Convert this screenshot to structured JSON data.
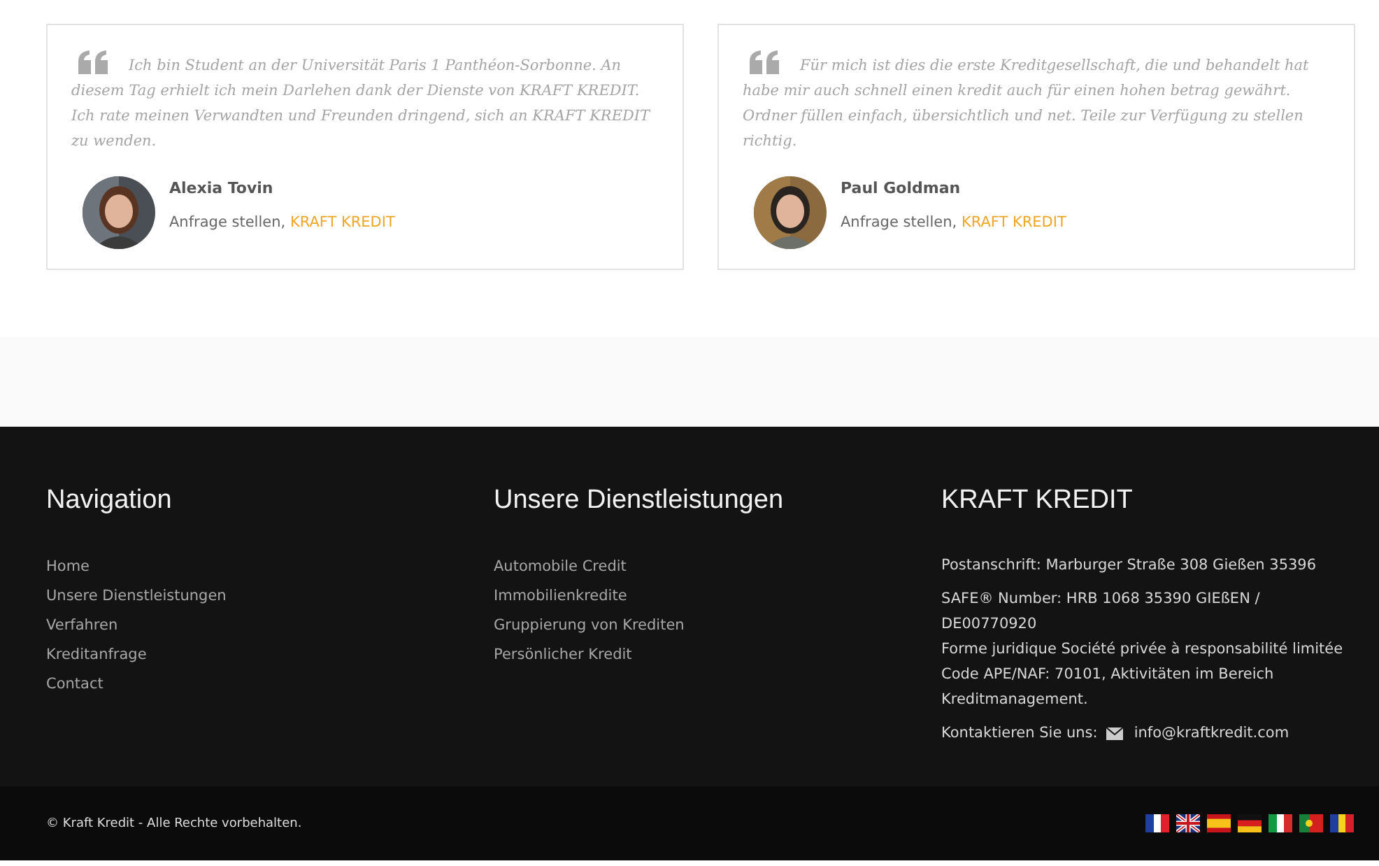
{
  "testimonials": [
    {
      "quote": "Ich bin Student an der Universität Paris 1 Panthéon-Sorbonne. An diesem Tag erhielt ich mein Darlehen dank der Dienste von KRAFT KREDIT. Ich rate meinen Verwandten und Freunden dringend, sich an KRAFT KREDIT zu wenden.",
      "name": "Alexia Tovin",
      "role": "Anfrage stellen,",
      "company": "KRAFT KREDIT"
    },
    {
      "quote": "Für mich ist dies die erste Kreditgesellschaft, die und behandelt hat habe mir auch schnell einen kredit auch für einen hohen betrag gewährt. Ordner füllen einfach, übersichtlich und net. Teile zur Verfügung zu stellen richtig.",
      "name": "Paul Goldman",
      "role": "Anfrage stellen,",
      "company": "KRAFT KREDIT"
    }
  ],
  "footer": {
    "navigation": {
      "title": "Navigation",
      "links": [
        "Home",
        "Unsere Dienstleistungen",
        "Verfahren",
        "Kreditanfrage",
        "Contact"
      ]
    },
    "services": {
      "title": "Unsere Dienstleistungen",
      "links": [
        "Automobile Credit",
        "Immobilienkredite",
        "Gruppierung von Krediten",
        "Persönlicher Kredit"
      ]
    },
    "company": {
      "title": "KRAFT KREDIT",
      "address": "Postanschrift: Marburger Straße 308 Gießen 35396",
      "legal": [
        "SAFE® Number: HRB 1068 35390 GIEßEN / DE00770920",
        "Forme juridique Société privée à responsabilité limitée",
        "Code APE/NAF: 70101, Aktivitäten im Bereich Kreditmanagement."
      ],
      "contact_label": "Kontaktieren Sie uns:",
      "email": "info@kraftkredit.com"
    }
  },
  "bottom_bar": {
    "copyright": "© Kraft Kredit - Alle Rechte vorbehalten.",
    "flags": [
      {
        "kind": "fr"
      },
      {
        "kind": "gb"
      },
      {
        "kind": "es"
      },
      {
        "kind": "de"
      },
      {
        "kind": "it"
      },
      {
        "kind": "pt"
      },
      {
        "kind": "ro"
      }
    ]
  }
}
